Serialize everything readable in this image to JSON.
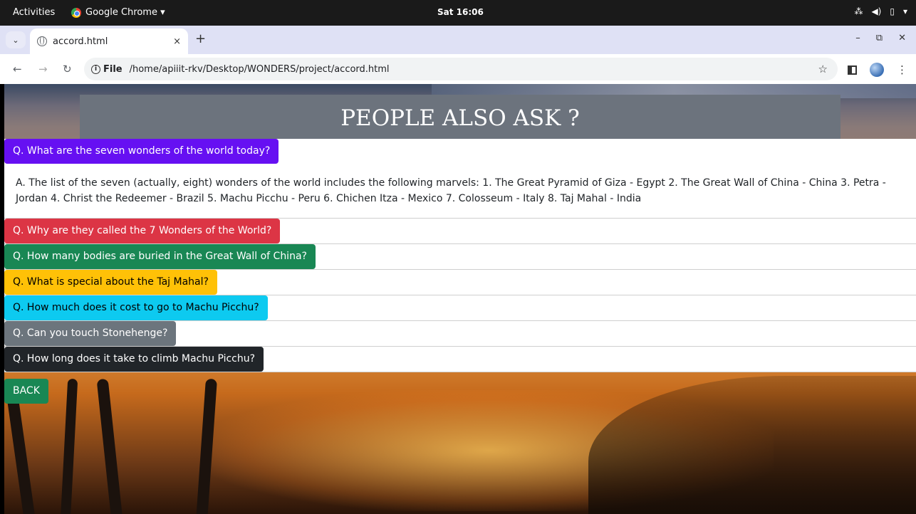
{
  "system": {
    "activities": "Activities",
    "app_name": "Google Chrome ▾",
    "clock": "Sat 16:06"
  },
  "browser": {
    "tab_title": "accord.html",
    "tab_close": "×",
    "new_tab": "+",
    "address_scheme": "File",
    "address_url": "/home/apiiit-rkv/Desktop/WONDERS/project/accord.html"
  },
  "page": {
    "banner_title": "PEOPLE ALSO ASK ?",
    "questions": [
      {
        "label": "Q. What are the seven wonders of the world today?",
        "color": "#6610f2",
        "text_color": "#ffffff"
      },
      {
        "label": "Q. Why are they called the 7 Wonders of the World?",
        "color": "#dc3545",
        "text_color": "#ffffff"
      },
      {
        "label": "Q. How many bodies are buried in the Great Wall of China?",
        "color": "#198754",
        "text_color": "#ffffff"
      },
      {
        "label": "Q. What is special about the Taj Mahal?",
        "color": "#ffc107",
        "text_color": "#000000"
      },
      {
        "label": "Q. How much does it cost to go to Machu Picchu?",
        "color": "#0dcaf0",
        "text_color": "#000000"
      },
      {
        "label": "Q. Can you touch Stonehenge?",
        "color": "#6c757d",
        "text_color": "#ffffff"
      },
      {
        "label": "Q. How long does it take to climb Machu Picchu?",
        "color": "#212529",
        "text_color": "#ffffff"
      }
    ],
    "answer_1": "A. The list of the seven (actually, eight) wonders of the world includes the following marvels: 1. The Great Pyramid of Giza - Egypt 2. The Great Wall of China - China 3. Petra - Jordan 4. Christ the Redeemer - Brazil 5. Machu Picchu - Peru 6. Chichen Itza - Mexico 7. Colosseum - Italy 8. Taj Mahal - India",
    "back_label": "BACK"
  }
}
